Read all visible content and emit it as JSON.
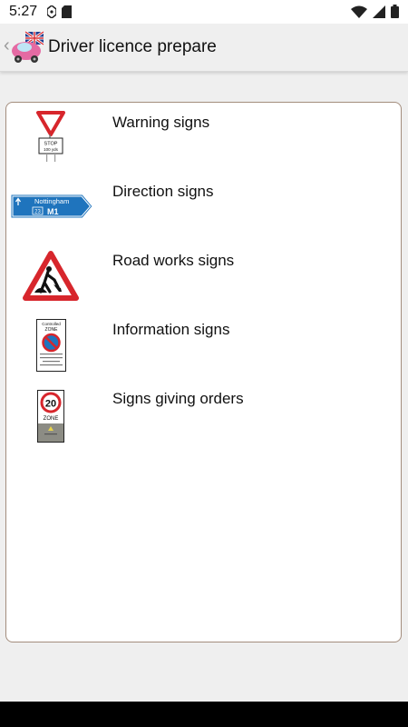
{
  "status_bar": {
    "time": "5:27",
    "icons_left": [
      "nfc-icon",
      "sim-card-icon"
    ],
    "icons_right": [
      "wifi-icon",
      "cellular-signal-icon",
      "battery-icon"
    ]
  },
  "app_bar": {
    "title": "Driver licence prepare",
    "back_icon": "chevron-left-icon",
    "logo_icon": "car-with-flag-logo"
  },
  "categories": [
    {
      "label": "Warning signs",
      "icon": "give-way-stop-sign-icon",
      "icon_text": [
        "STOP",
        "100 yds"
      ]
    },
    {
      "label": "Direction signs",
      "icon": "motorway-direction-sign-icon",
      "icon_text": [
        "Nottingham",
        "23",
        "M1"
      ]
    },
    {
      "label": "Road works signs",
      "icon": "road-works-sign-icon"
    },
    {
      "label": "Information signs",
      "icon": "controlled-zone-sign-icon",
      "icon_text": [
        "Controlled",
        "ZONE"
      ]
    },
    {
      "label": "Signs giving orders",
      "icon": "20-zone-sign-icon",
      "icon_text": [
        "20",
        "ZONE"
      ]
    }
  ],
  "colors": {
    "background": "#efefef",
    "card_border": "#a38d7d",
    "sign_red": "#d7262c",
    "sign_blue": "#1f74bd"
  }
}
